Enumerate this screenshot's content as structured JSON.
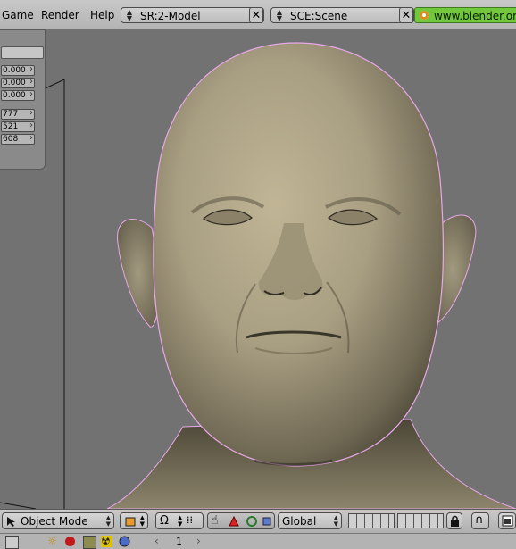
{
  "menu": [
    "Game",
    "Render",
    "Help"
  ],
  "screen_selector": {
    "label": "SR:2-Model"
  },
  "scene_selector": {
    "label": "SCE:Scene"
  },
  "website_button": {
    "label": "www.blender.org"
  },
  "transform_panel": {
    "location": [
      "0.000",
      "0.000",
      "0.000"
    ],
    "rotation": [
      "777",
      "521",
      "608"
    ]
  },
  "view3d_header": {
    "mode": "Object Mode",
    "orientation": "Global"
  },
  "timeline": {
    "frame": "1"
  },
  "colors": {
    "background": "#727272",
    "header": "#b8b8b8",
    "website_button": "#71c83c",
    "skin": "#a89e82",
    "selection_outline": "#e8a8e8"
  },
  "icons": [
    "arrows-updown-icon",
    "close-icon",
    "blender-logo-icon",
    "cursor-icon",
    "object-box-icon",
    "pivot-icon",
    "hand-icon",
    "translate-icon",
    "rotate-icon",
    "scale-icon",
    "lock-icon",
    "magnet-icon",
    "render-icon",
    "sun-icon",
    "sphere-icon",
    "world-icon",
    "radiation-icon"
  ]
}
